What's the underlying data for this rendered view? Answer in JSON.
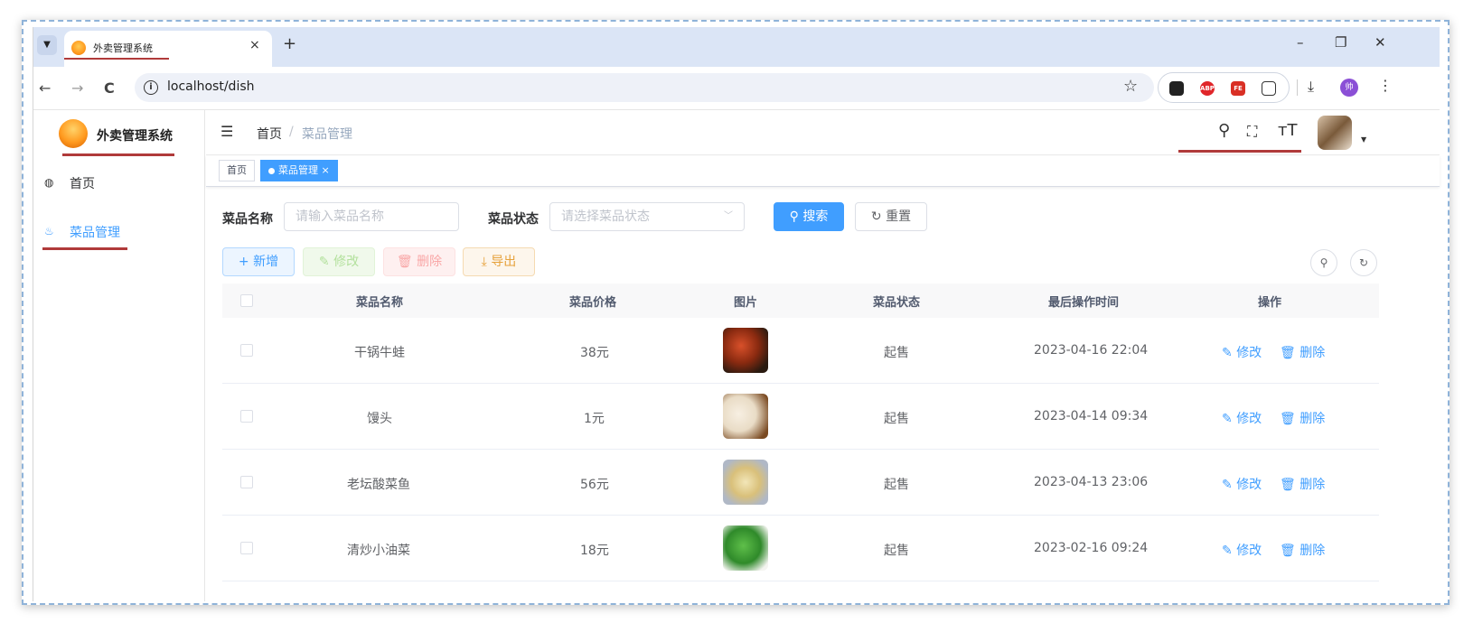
{
  "browser": {
    "tab_menu_icon": "chevron-down-icon",
    "tab_title": "外卖管理系统",
    "tab_close": "×",
    "new_tab": "+",
    "window_controls": {
      "minimize": "–",
      "restore": "❐",
      "close": "✕"
    },
    "nav": {
      "back": "←",
      "forward": "→",
      "reload": "C"
    },
    "url": "localhost/dish",
    "info_icon": "i",
    "star": "☆",
    "extensions": [
      "ghost-icon",
      "adblock-icon",
      "fe-icon",
      "puzzle-icon"
    ],
    "extension_labels": [
      "",
      "ABP",
      "FE",
      ""
    ],
    "download": "⤓",
    "profile_initial": "帅",
    "kebab": "⋮"
  },
  "sidebar": {
    "logo_text": "外卖管理系统",
    "items": [
      {
        "label": "首页",
        "icon": "dashboard-icon",
        "active": false
      },
      {
        "label": "菜品管理",
        "icon": "dish-icon",
        "active": true
      }
    ]
  },
  "navbar": {
    "breadcrumb_home": "首页",
    "breadcrumb_sep": "/",
    "breadcrumb_current": "菜品管理"
  },
  "tags": [
    {
      "label": "首页",
      "active": false
    },
    {
      "label": "菜品管理",
      "active": true,
      "close": "×"
    }
  ],
  "search": {
    "name_label": "菜品名称",
    "name_placeholder": "请输入菜品名称",
    "status_label": "菜品状态",
    "status_placeholder": "请选择菜品状态",
    "search_btn": "搜索",
    "reset_btn": "重置"
  },
  "actions": {
    "add": "新增",
    "edit": "修改",
    "delete": "删除",
    "export": "导出"
  },
  "table": {
    "headers": [
      "菜品名称",
      "菜品价格",
      "图片",
      "菜品状态",
      "最后操作时间",
      "操作"
    ],
    "rows": [
      {
        "name": "干锅牛蛙",
        "price": "38元",
        "status": "起售",
        "time": "2023-04-16 22:04",
        "edit": "修改",
        "delete": "删除"
      },
      {
        "name": "馒头",
        "price": "1元",
        "status": "起售",
        "time": "2023-04-14 09:34",
        "edit": "修改",
        "delete": "删除"
      },
      {
        "name": "老坛酸菜鱼",
        "price": "56元",
        "status": "起售",
        "time": "2023-04-13 23:06",
        "edit": "修改",
        "delete": "删除"
      },
      {
        "name": "清炒小油菜",
        "price": "18元",
        "status": "起售",
        "time": "2023-02-16 09:24",
        "edit": "修改",
        "delete": "删除"
      }
    ]
  },
  "colors": {
    "primary": "#409eff",
    "annotation": "#b03a3a"
  }
}
